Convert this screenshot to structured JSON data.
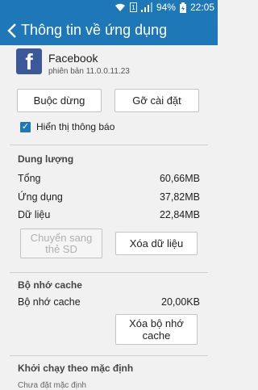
{
  "status": {
    "battery_percent": "94%",
    "time": "22:05",
    "sim": "1"
  },
  "header": {
    "title": "Thông tin về ứng dụng"
  },
  "app": {
    "name": "Facebook",
    "version": "phiên bản 11.0.0.11.23",
    "logo_letter": "f"
  },
  "actions": {
    "force_stop": "Buộc dừng",
    "uninstall": "Gỡ cài đặt"
  },
  "notifications": {
    "label": "Hiển thị thông báo",
    "checked": true
  },
  "storage": {
    "header": "Dung lượng",
    "rows": [
      {
        "label": "Tổng",
        "value": "60,66MB"
      },
      {
        "label": "Ứng dụng",
        "value": "37,82MB"
      },
      {
        "label": "Dữ liệu",
        "value": "22,84MB"
      }
    ],
    "move_to_sd": "Chuyển sang thẻ SD",
    "clear_data": "Xóa dữ liệu"
  },
  "cache": {
    "header": "Bộ nhớ cache",
    "row": {
      "label": "Bộ nhớ cache",
      "value": "20,00KB"
    },
    "clear_cache": "Xóa bộ nhớ cache"
  },
  "launch": {
    "header": "Khởi chạy theo mặc định",
    "subtext": "Chưa đặt mặc định"
  },
  "colors": {
    "accent": "#1e77b6",
    "facebook": "#3b5998"
  },
  "icons": [
    "wifi-icon",
    "sim-icon",
    "signal-icon",
    "battery-icon",
    "back-arrow-icon",
    "check-icon"
  ]
}
